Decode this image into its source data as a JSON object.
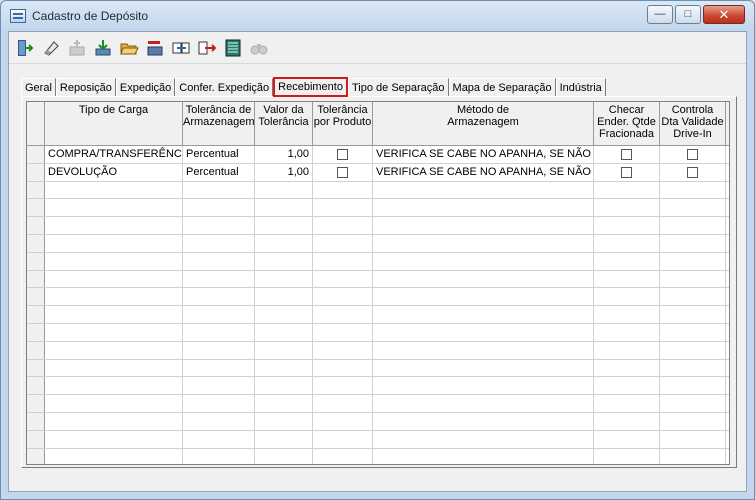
{
  "window": {
    "title": "Cadastro de Depósito"
  },
  "toolbar": {
    "buttons": [
      {
        "icon": "exit-icon"
      },
      {
        "icon": "eraser-icon"
      },
      {
        "icon": "add-disabled-icon"
      },
      {
        "icon": "download-icon"
      },
      {
        "icon": "folder-open-icon"
      },
      {
        "icon": "red-arrow-icon"
      },
      {
        "icon": "insert-icon"
      },
      {
        "icon": "export-icon"
      },
      {
        "icon": "list-icon"
      },
      {
        "icon": "binoculars-icon"
      }
    ]
  },
  "tabs": [
    {
      "label": "Geral"
    },
    {
      "label": "Reposição"
    },
    {
      "label": "Expedição"
    },
    {
      "label": "Confer. Expedição"
    },
    {
      "label": "Recebimento",
      "active": true
    },
    {
      "label": "Tipo de Separação"
    },
    {
      "label": "Mapa de Separação"
    },
    {
      "label": "Indústria"
    }
  ],
  "grid": {
    "columns": [
      "Tipo de Carga",
      "Tolerância de\nArmazenagem",
      "Valor da\nTolerância",
      "Tolerância\npor Produto",
      "Método de\nArmazenagem",
      "Checar\nEnder. Qtde\nFracionada",
      "Controla\nDta Validade\nDrive-In"
    ],
    "rows": [
      {
        "tipo": "COMPRA/TRANSFERÊNC",
        "tolerancia": "Percentual",
        "valor": "1,00",
        "metodo": "VERIFICA SE CABE NO APANHA, SE NÃO A"
      },
      {
        "tipo": "DEVOLUÇÃO",
        "tolerancia": "Percentual",
        "valor": "1,00",
        "metodo": "VERIFICA SE CABE NO APANHA, SE NÃO A"
      }
    ]
  }
}
